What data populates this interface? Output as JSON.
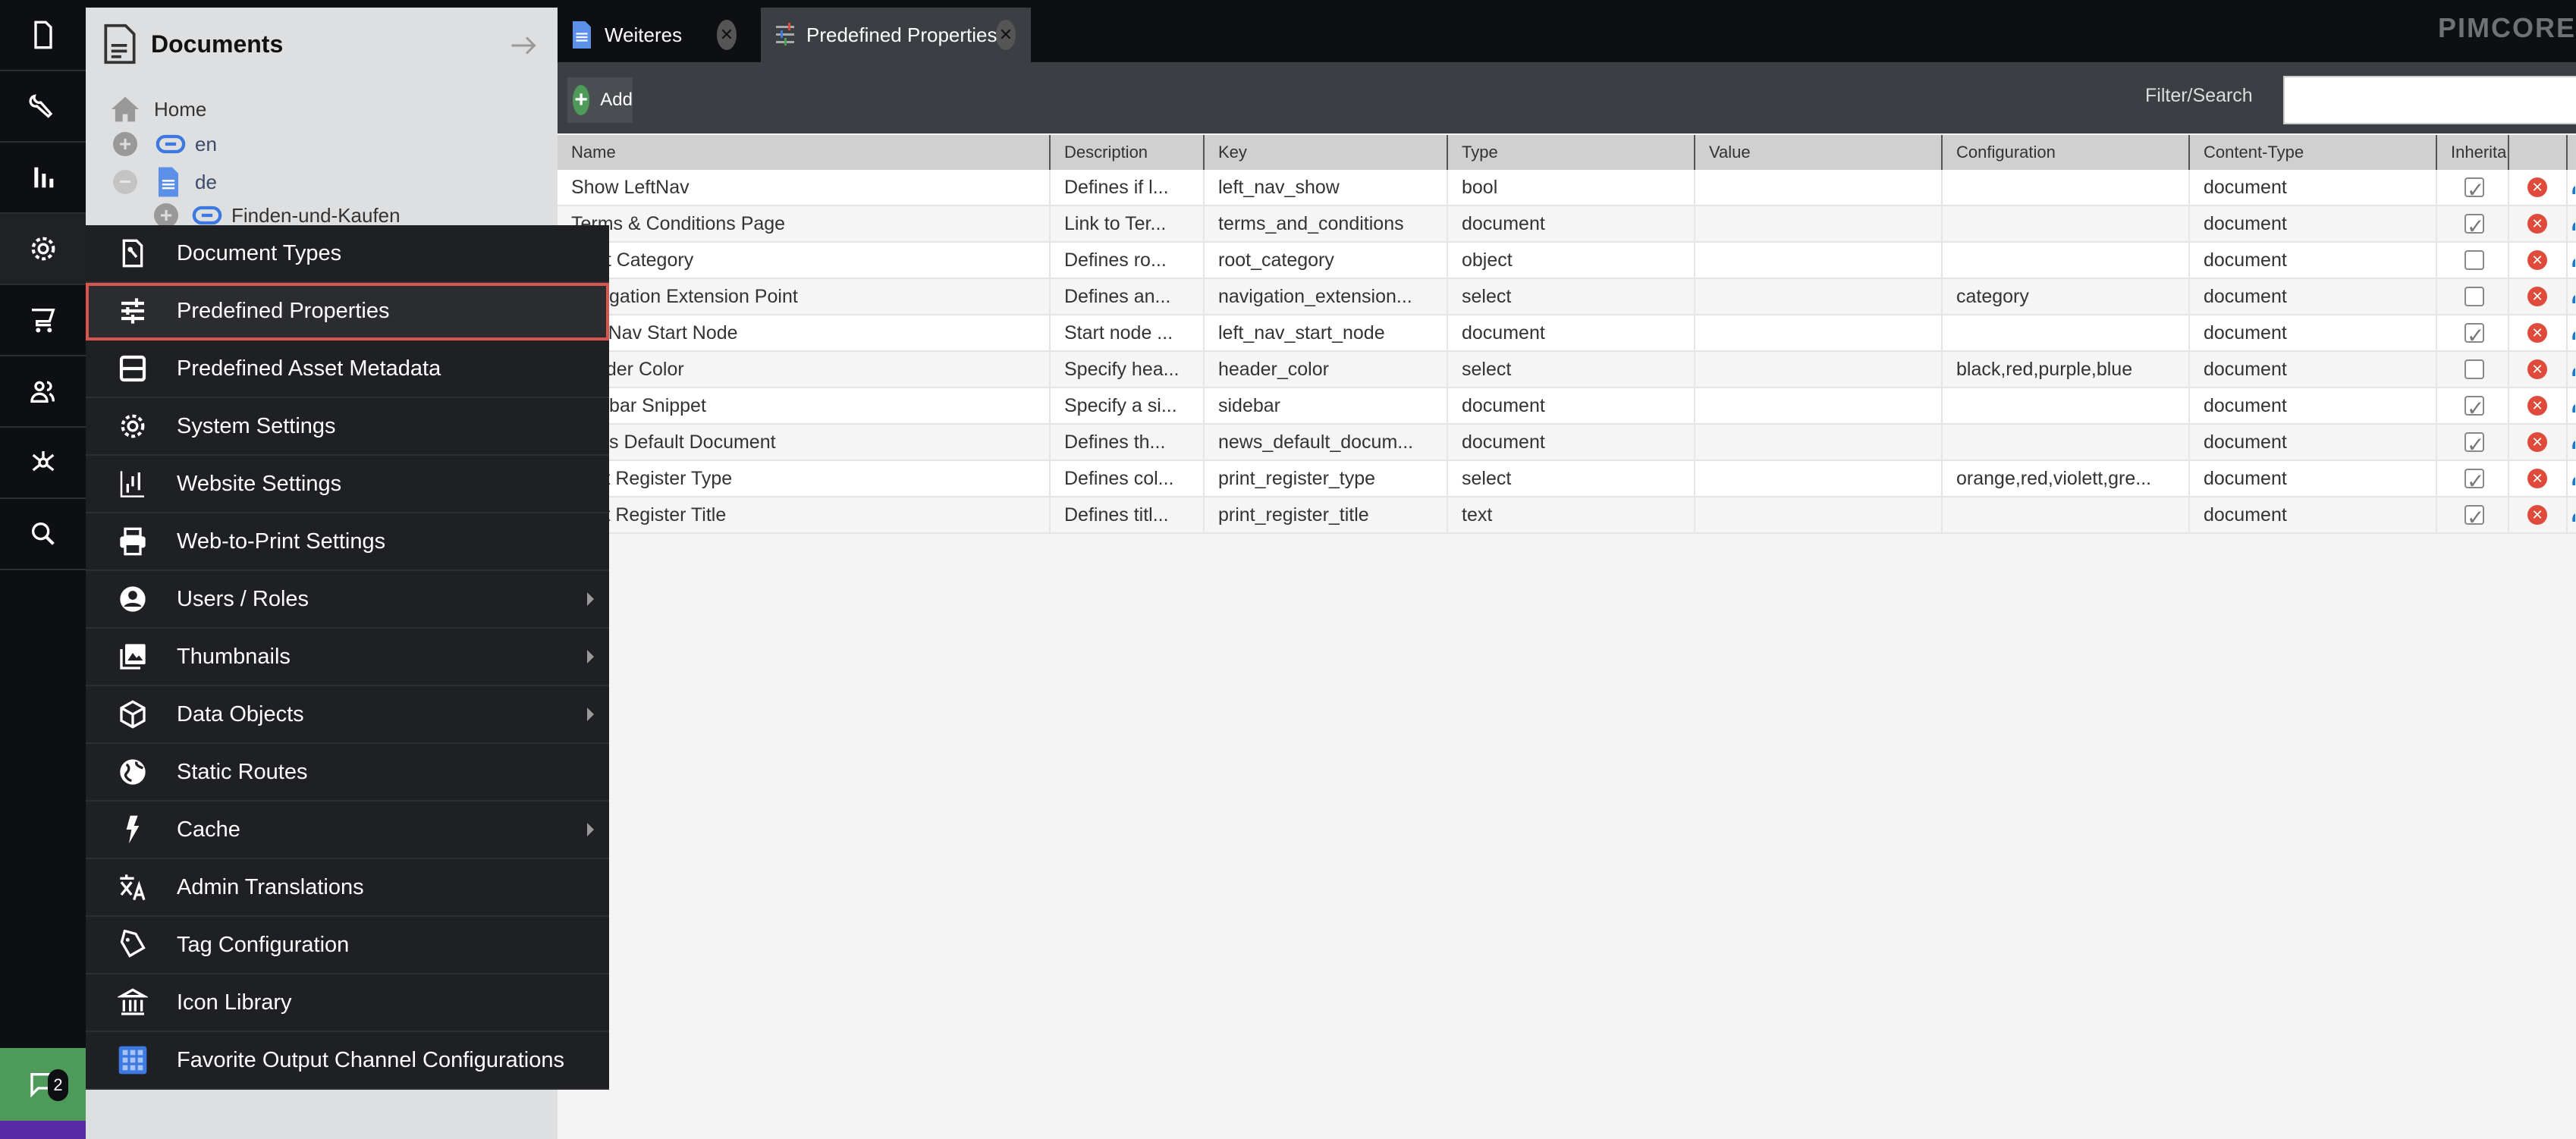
{
  "iconbar": {
    "items": [
      {
        "icon": "document-icon"
      },
      {
        "icon": "wrench-icon"
      },
      {
        "icon": "bar-chart-icon"
      },
      {
        "icon": "gear-icon"
      },
      {
        "icon": "cart-icon"
      },
      {
        "icon": "users-icon"
      },
      {
        "icon": "network-icon"
      },
      {
        "icon": "search-icon"
      }
    ],
    "notifications_count": "2"
  },
  "tree": {
    "title": "Documents",
    "nodes": [
      {
        "label": "Home",
        "icon": "home-icon"
      },
      {
        "label": "en",
        "icon": "link-icon"
      },
      {
        "label": "de",
        "icon": "page-icon"
      },
      {
        "label": "Finden-und-Kaufen",
        "icon": "link-icon"
      }
    ]
  },
  "tabs": [
    {
      "label": "Weiteres",
      "icon": "page-icon"
    },
    {
      "label": "Predefined Properties",
      "icon": "sliders-icon",
      "active": true
    }
  ],
  "brand": "PIMCORE",
  "toolbar": {
    "add_label": "Add",
    "filter_label": "Filter/Search",
    "filter_value": ""
  },
  "grid": {
    "columns": [
      "Name",
      "Description",
      "Key",
      "Type",
      "Value",
      "Configuration",
      "Content-Type",
      "Inherita",
      "",
      ""
    ],
    "rows": [
      {
        "name": "Show LeftNav",
        "description": "Defines if l...",
        "key": "left_nav_show",
        "type": "bool",
        "value": "",
        "configuration": "",
        "content_type": "document",
        "inheritable": true
      },
      {
        "name": "Terms & Conditions Page",
        "description": "Link to Ter...",
        "key": "terms_and_conditions",
        "type": "document",
        "value": "",
        "configuration": "",
        "content_type": "document",
        "inheritable": true
      },
      {
        "name": "Root Category",
        "description": "Defines ro...",
        "key": "root_category",
        "type": "object",
        "value": "",
        "configuration": "",
        "content_type": "document",
        "inheritable": false
      },
      {
        "name": "Navigation Extension Point",
        "description": "Defines an...",
        "key": "navigation_extension...",
        "type": "select",
        "value": "",
        "configuration": "category",
        "content_type": "document",
        "inheritable": false
      },
      {
        "name": "Left Nav Start Node",
        "description": "Start node ...",
        "key": "left_nav_start_node",
        "type": "document",
        "value": "",
        "configuration": "",
        "content_type": "document",
        "inheritable": true
      },
      {
        "name": "Header Color",
        "description": "Specify hea...",
        "key": "header_color",
        "type": "select",
        "value": "",
        "configuration": "black,red,purple,blue",
        "content_type": "document",
        "inheritable": false
      },
      {
        "name": "Sidebar Snippet",
        "description": "Specify a si...",
        "key": "sidebar",
        "type": "document",
        "value": "",
        "configuration": "",
        "content_type": "document",
        "inheritable": true
      },
      {
        "name": "News Default Document",
        "description": "Defines th...",
        "key": "news_default_docum...",
        "type": "document",
        "value": "",
        "configuration": "",
        "content_type": "document",
        "inheritable": true
      },
      {
        "name": "Print Register Type",
        "description": "Defines col...",
        "key": "print_register_type",
        "type": "select",
        "value": "",
        "configuration": "orange,red,violett,gre...",
        "content_type": "document",
        "inheritable": true
      },
      {
        "name": "Print Register Title",
        "description": "Defines titl...",
        "key": "print_register_title",
        "type": "text",
        "value": "",
        "configuration": "",
        "content_type": "document",
        "inheritable": true
      }
    ]
  },
  "menu": {
    "items": [
      {
        "label": "Document Types",
        "icon": "document-wrench-icon",
        "submenu": false
      },
      {
        "label": "Predefined Properties",
        "icon": "sliders-icon",
        "submenu": false,
        "selected": true
      },
      {
        "label": "Predefined Asset Metadata",
        "icon": "metadata-icon",
        "submenu": false
      },
      {
        "label": "System Settings",
        "icon": "gear-icon",
        "submenu": false
      },
      {
        "label": "Website Settings",
        "icon": "website-settings-icon",
        "submenu": false
      },
      {
        "label": "Web-to-Print Settings",
        "icon": "printer-icon",
        "submenu": false
      },
      {
        "label": "Users / Roles",
        "icon": "user-icon",
        "submenu": true
      },
      {
        "label": "Thumbnails",
        "icon": "images-icon",
        "submenu": true
      },
      {
        "label": "Data Objects",
        "icon": "cube-icon",
        "submenu": true
      },
      {
        "label": "Static Routes",
        "icon": "globe-icon",
        "submenu": false
      },
      {
        "label": "Cache",
        "icon": "lightning-icon",
        "submenu": true
      },
      {
        "label": "Admin Translations",
        "icon": "translate-icon",
        "submenu": false
      },
      {
        "label": "Tag Configuration",
        "icon": "tag-icon",
        "submenu": false
      },
      {
        "label": "Icon Library",
        "icon": "library-icon",
        "submenu": false
      },
      {
        "label": "Favorite Output Channel Configurations",
        "icon": "grid-icon",
        "submenu": false
      }
    ]
  },
  "colors": {
    "accent_green": "#4e9a5a",
    "delete_red": "#e04a3a",
    "selection_outline": "#d9534f",
    "link_blue": "#3b6fd6"
  }
}
